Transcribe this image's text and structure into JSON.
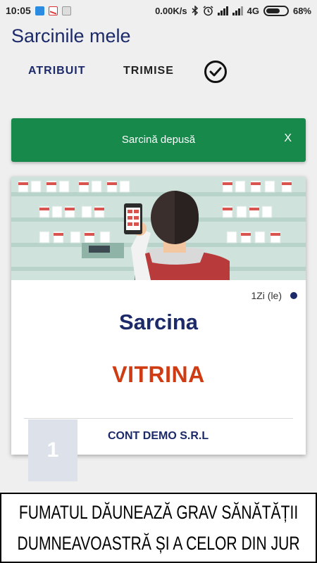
{
  "status_bar": {
    "time": "10:05",
    "network_speed": "0.00K/s",
    "network_type": "4G",
    "battery_percent": "68%",
    "battery_level": 0.68,
    "icons": [
      "app-notification-icon",
      "mail-icon",
      "image-icon",
      "bluetooth-icon",
      "alarm-icon",
      "signal-icon",
      "signal-icon",
      "battery-icon"
    ]
  },
  "header": {
    "title": "Sarcinile mele"
  },
  "tabs": [
    {
      "label": "ATRIBUIT"
    },
    {
      "label": "TRIMISE"
    },
    {
      "icon": "check-circle-icon"
    }
  ],
  "snackbar": {
    "text": "Sarcină depusă",
    "close_label": "X",
    "color": "#17894b"
  },
  "task_card": {
    "due": "1Zi (le)",
    "label": "Sarcina",
    "name": "VITRINA",
    "company": "CONT DEMO S.R.L",
    "number": "1",
    "label_color": "#1d2a6a",
    "name_color": "#cf3b12"
  },
  "health_warning": {
    "line1": "FUMATUL DĂUNEAZĂ GRAV SĂNĂTĂȚII",
    "line2": "DUMNEAVOASTRĂ ȘI A CELOR DIN JUR"
  }
}
